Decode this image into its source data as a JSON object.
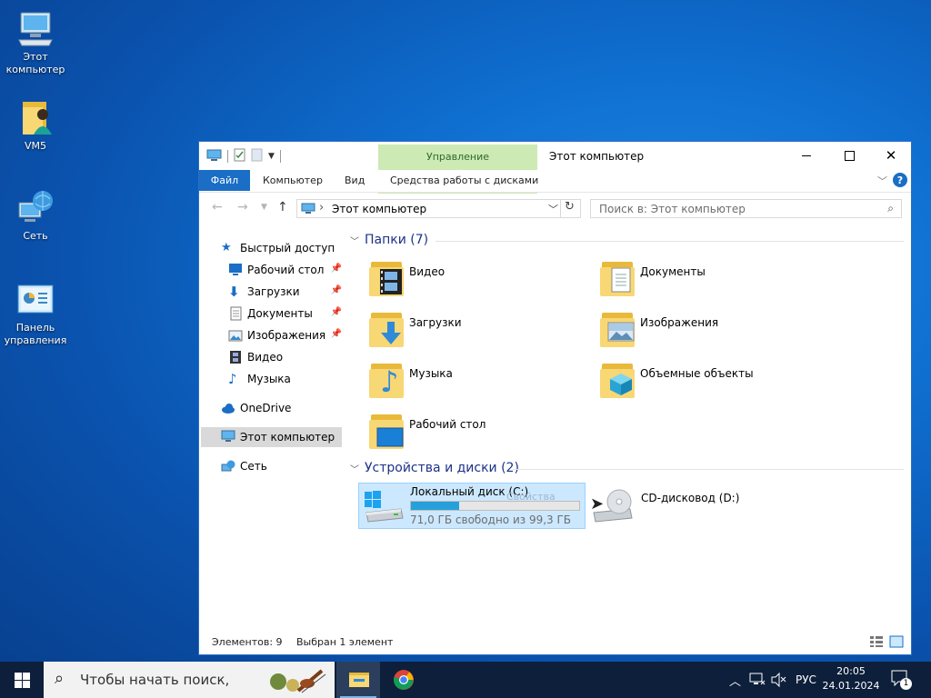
{
  "desktop": {
    "icons": [
      {
        "label": "Этот\nкомпьютер",
        "icon": "computer-icon"
      },
      {
        "label": "VM5",
        "icon": "user-folder-icon"
      },
      {
        "label": "Сеть",
        "icon": "network-icon"
      },
      {
        "label": "Панель\nуправления",
        "icon": "control-panel-icon"
      }
    ]
  },
  "window": {
    "title": "Этот компьютер",
    "contextual_tab_group": "Управление",
    "ribbon_tabs": [
      "Файл",
      "Компьютер",
      "Вид",
      "Средства работы с дисками"
    ],
    "help_label": "?",
    "address_text": "Этот компьютер",
    "address_chevron": "›",
    "search_placeholder": "Поиск в: Этот компьютер",
    "accent": "#1a6ec5",
    "manage_color": "#cde9b4"
  },
  "nav_pane": {
    "quick_access": "Быстрый доступ",
    "quick_items": [
      {
        "label": "Рабочий стол",
        "pinned": true
      },
      {
        "label": "Загрузки",
        "pinned": true
      },
      {
        "label": "Документы",
        "pinned": true
      },
      {
        "label": "Изображения",
        "pinned": true
      },
      {
        "label": "Видео",
        "pinned": false
      },
      {
        "label": "Музыка",
        "pinned": false
      }
    ],
    "onedrive": "OneDrive",
    "this_pc": "Этот компьютер",
    "network": "Сеть"
  },
  "content": {
    "folders_header": "Папки (7)",
    "folders": [
      "Видео",
      "Документы",
      "Загрузки",
      "Изображения",
      "Музыка",
      "Объемные объекты",
      "Рабочий стол"
    ],
    "devices_header": "Устройства и диски (2)",
    "drive_c": {
      "name": "Локальный диск (C:)",
      "free_text": "71,0 ГБ свободно из 99,3 ГБ",
      "used_fraction": 0.285,
      "ghost_text": "Свойства"
    },
    "drive_d": {
      "name": "CD-дисковод (D:)"
    }
  },
  "status": {
    "items": "Элементов: 9",
    "selected": "Выбран 1 элемент"
  },
  "taskbar": {
    "search_placeholder": "Чтобы начать поиск,",
    "language": "РУС",
    "time": "20:05",
    "date": "24.01.2024",
    "notification_count": "1"
  }
}
